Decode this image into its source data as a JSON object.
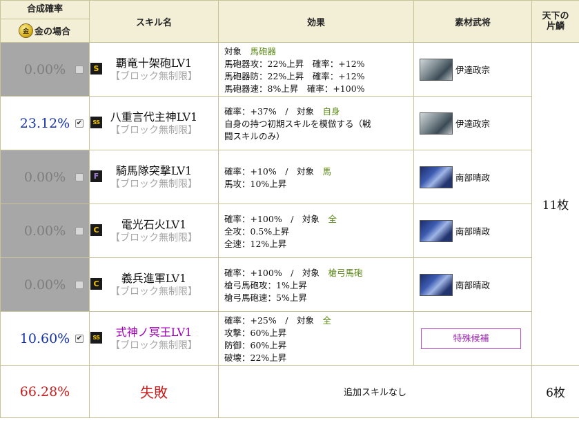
{
  "header": {
    "rate_title": "合成確率",
    "gold_label": "金の場合",
    "coin_glyph": "金",
    "skill_title": "スキル名",
    "effect_title": "効果",
    "material_title": "素材武将",
    "tenka_title_1": "天下の",
    "tenka_title_2": "片鱗"
  },
  "rows": [
    {
      "rate": "0.00%",
      "checked": false,
      "rank": "S",
      "skill": "覇竜十架砲LV1",
      "restriction": "【ブロック無制限】",
      "effect": [
        {
          "a": "対象",
          "g": "馬砲器"
        },
        {
          "a": "馬砲器攻：22%上昇　確率：+12%"
        },
        {
          "a": "馬砲器防：22%上昇　確率：+12%"
        },
        {
          "a": "馬砲器速：8%上昇　確率：+100%"
        }
      ],
      "material": "伊達政宗"
    },
    {
      "rate": "23.12%",
      "checked": true,
      "rank": "SS",
      "skill": "八重言代主神LV1",
      "restriction": "【ブロック無制限】",
      "effect": [
        {
          "a": "確率：+37%　/　対象",
          "g": "自身"
        },
        {
          "a": "自身の持つ初期スキルを模倣する（戦"
        },
        {
          "a": "闘スキルのみ）"
        }
      ],
      "material": "伊達政宗"
    },
    {
      "rate": "0.00%",
      "checked": false,
      "rank": "F",
      "skill": "騎馬隊突撃LV1",
      "restriction": "【ブロック無制限】",
      "effect": [
        {
          "a": "確率：+10%　/　対象",
          "g": "馬"
        },
        {
          "a": "馬攻：10%上昇"
        }
      ],
      "material": "南部晴政"
    },
    {
      "rate": "0.00%",
      "checked": false,
      "rank": "C",
      "skill": "電光石火LV1",
      "restriction": "【ブロック無制限】",
      "effect": [
        {
          "a": "確率：+100%　/　対象",
          "g": "全"
        },
        {
          "a": "全攻：0.5%上昇"
        },
        {
          "a": "全速：12%上昇"
        }
      ],
      "material": "南部晴政"
    },
    {
      "rate": "0.00%",
      "checked": false,
      "rank": "C",
      "skill": "義兵進軍LV1",
      "restriction": "【ブロック無制限】",
      "effect": [
        {
          "a": "確率：+100%　/　対象",
          "g": "槍弓馬砲"
        },
        {
          "a": "槍弓馬砲攻：1%上昇"
        },
        {
          "a": "槍弓馬砲速：5%上昇"
        }
      ],
      "material": "南部晴政"
    },
    {
      "rate": "10.60%",
      "checked": true,
      "rank": "SS",
      "skill": "式神ノ冥王LV1",
      "restriction": "【ブロック無制限】",
      "effect": [
        {
          "a": "確率：+25%　/　対象",
          "g": "全"
        },
        {
          "a": "攻撃：60%上昇"
        },
        {
          "a": "防御：60%上昇"
        },
        {
          "a": "破壊：22%上昇"
        }
      ],
      "material_button": "特殊候補"
    }
  ],
  "tenka_count": "11枚",
  "fail": {
    "rate": "66.28%",
    "label": "失敗",
    "effect": "追加スキルなし",
    "count": "6枚"
  },
  "colors": {
    "gray_cell": "#a7a7a7",
    "blue_rate": "#1432a8",
    "fail_red": "#c71f1f",
    "effect_green": "#5b8a16",
    "special_purple": "#9b26b0"
  }
}
